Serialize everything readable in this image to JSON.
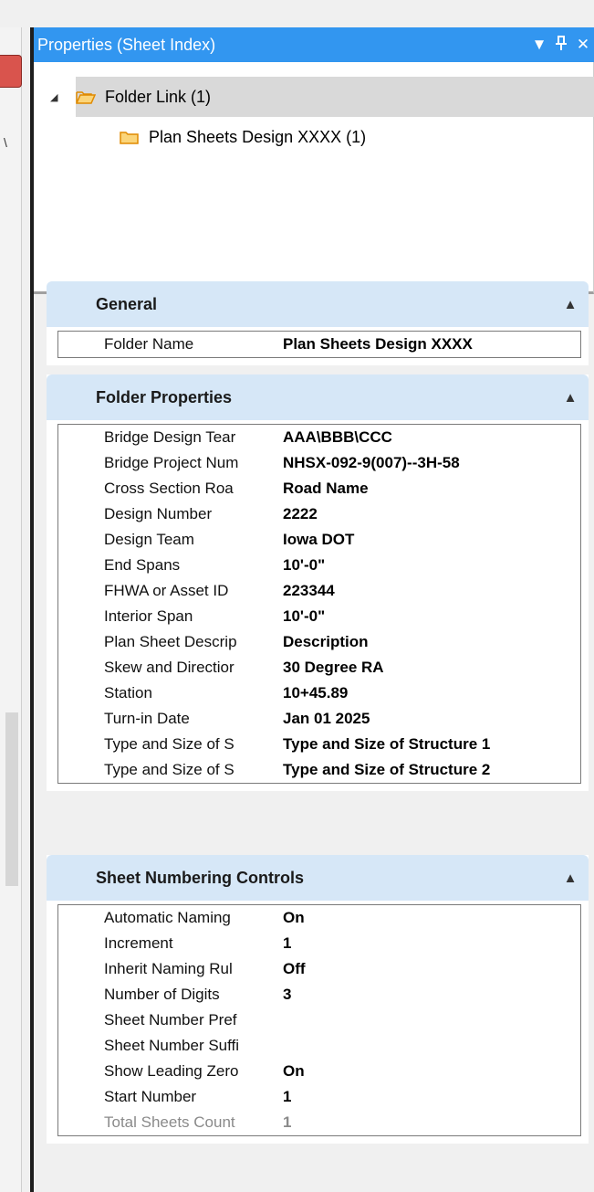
{
  "panel": {
    "title": "Properties (Sheet Index)",
    "controls": {
      "dropdown": "▼",
      "pin": "ꟼ",
      "close": "✕"
    }
  },
  "tree": {
    "items": [
      {
        "label": "Folder Link (1)",
        "expander": "◢",
        "icon": "folder-open-icon"
      },
      {
        "label": "Plan Sheets Design XXXX (1)",
        "icon": "folder-icon"
      }
    ]
  },
  "sections": {
    "general": {
      "title": "General",
      "rows": [
        {
          "name": "Folder Name",
          "value": "Plan Sheets Design XXXX"
        }
      ]
    },
    "folder_properties": {
      "title": "Folder Properties",
      "rows": [
        {
          "name": "Bridge Design Tear",
          "value": "AAA\\BBB\\CCC"
        },
        {
          "name": "Bridge Project Num",
          "value": "NHSX-092-9(007)--3H-58"
        },
        {
          "name": "Cross Section Roa",
          "value": "Road Name"
        },
        {
          "name": "Design Number",
          "value": "2222"
        },
        {
          "name": "Design Team",
          "value": "Iowa DOT"
        },
        {
          "name": "End Spans",
          "value": "10'-0\""
        },
        {
          "name": "FHWA or Asset ID",
          "value": "223344"
        },
        {
          "name": "Interior Span",
          "value": "10'-0\""
        },
        {
          "name": "Plan Sheet Descrip",
          "value": "Description"
        },
        {
          "name": "Skew and Directior",
          "value": "30 Degree RA"
        },
        {
          "name": "Station",
          "value": "10+45.89"
        },
        {
          "name": "Turn-in Date",
          "value": "Jan 01 2025"
        },
        {
          "name": "Type and Size of S",
          "value": "Type and Size of Structure 1"
        },
        {
          "name": "Type and Size of S",
          "value": "Type and Size of Structure 2"
        }
      ]
    },
    "sheet_numbering": {
      "title": "Sheet Numbering Controls",
      "rows": [
        {
          "name": "Automatic Naming",
          "value": "On"
        },
        {
          "name": "Increment",
          "value": "1"
        },
        {
          "name": "Inherit Naming Rul",
          "value": "Off"
        },
        {
          "name": "Number of Digits",
          "value": "3"
        },
        {
          "name": "Sheet Number Pref",
          "value": ""
        },
        {
          "name": "Sheet Number Suffi",
          "value": ""
        },
        {
          "name": "Show Leading Zero",
          "value": "On"
        },
        {
          "name": "Start Number",
          "value": "1"
        },
        {
          "name": "Total Sheets Count",
          "value": "1",
          "disabled": true
        }
      ]
    }
  },
  "colors": {
    "titlebar": "#3296f0",
    "section_header": "#d6e7f7",
    "selection": "#d9d9d9",
    "folder": "#f5a623"
  }
}
